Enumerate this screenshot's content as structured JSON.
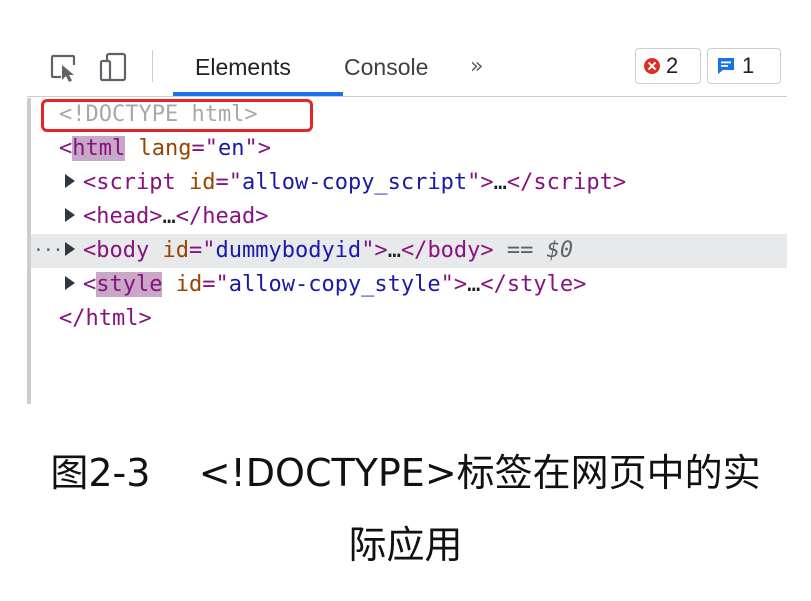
{
  "toolbar": {
    "tabs": [
      {
        "label": "Elements",
        "active": true
      },
      {
        "label": "Console",
        "active": false
      }
    ],
    "more_tabs": "»",
    "errors_count": "2",
    "issues_count": "1"
  },
  "tree": {
    "doctype": "<!DOCTYPE html>",
    "html_open": {
      "tag": "html",
      "attr": "lang",
      "value": "en"
    },
    "children": [
      {
        "tag": "script",
        "attr": "id",
        "value": "allow-copy_script",
        "ellipsis": "…"
      },
      {
        "tag": "head",
        "ellipsis": "…"
      },
      {
        "tag": "body",
        "attr": "id",
        "value": "dummybodyid",
        "ellipsis": "…",
        "suffix": "== $0",
        "selected": true
      },
      {
        "tag": "style",
        "attr": "id",
        "value": "allow-copy_style",
        "ellipsis": "…"
      }
    ],
    "html_close": "</html>",
    "row_prefix": "···"
  },
  "caption": {
    "line1": "图2-3    <!DOCTYPE>标签在网页中的实",
    "line2": "际应用"
  },
  "colors": {
    "accent": "#1a73e8",
    "error": "#d93025",
    "highlight_box": "#e52525",
    "tag": "#881280",
    "attr": "#994500",
    "value": "#1a1aa6"
  },
  "icons": [
    "inspect-element-icon",
    "device-toolbar-icon",
    "error-icon",
    "issues-icon",
    "expand-arrow-icon"
  ]
}
